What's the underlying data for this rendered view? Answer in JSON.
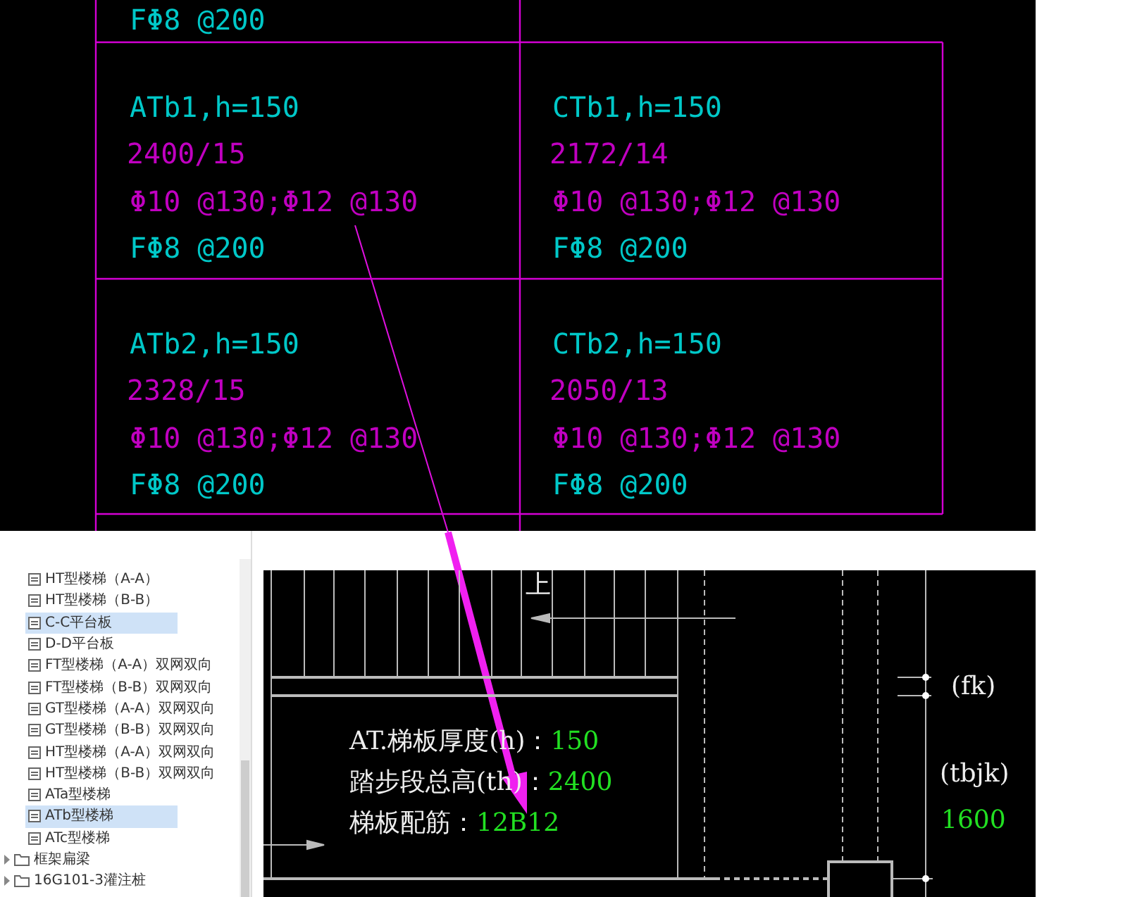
{
  "cad_table": {
    "partial_cell": "FΦ8 @200",
    "cells": [
      {
        "title": "ATb1,h=150",
        "ratio": "2400/15",
        "rebar": "Φ10 @130;Φ12 @130",
        "distribution": "FΦ8 @200"
      },
      {
        "title": "CTb1,h=150",
        "ratio": "2172/14",
        "rebar": "Φ10 @130;Φ12 @130",
        "distribution": "FΦ8 @200"
      },
      {
        "title": "ATb2,h=150",
        "ratio": "2328/15",
        "rebar": "Φ10 @130;Φ12 @130",
        "distribution": "FΦ8 @200"
      },
      {
        "title": "CTb2,h=150",
        "ratio": "2050/13",
        "rebar": "Φ10 @130;Φ12 @130",
        "distribution": "FΦ8 @200"
      }
    ]
  },
  "tree": {
    "items": [
      {
        "kind": "file",
        "label": "HT型楼梯（A-A）",
        "selected": false
      },
      {
        "kind": "file",
        "label": "HT型楼梯（B-B）",
        "selected": false
      },
      {
        "kind": "file",
        "label": "C-C平台板",
        "selected": true
      },
      {
        "kind": "file",
        "label": "D-D平台板",
        "selected": false
      },
      {
        "kind": "file",
        "label": "FT型楼梯（A-A）双网双向",
        "selected": false
      },
      {
        "kind": "file",
        "label": "FT型楼梯（B-B）双网双向",
        "selected": false
      },
      {
        "kind": "file",
        "label": "GT型楼梯（A-A）双网双向",
        "selected": false
      },
      {
        "kind": "file",
        "label": "GT型楼梯（B-B）双网双向",
        "selected": false
      },
      {
        "kind": "file",
        "label": "HT型楼梯（A-A）双网双向",
        "selected": false
      },
      {
        "kind": "file",
        "label": "HT型楼梯（B-B）双网双向",
        "selected": false
      },
      {
        "kind": "file",
        "label": "ATa型楼梯",
        "selected": false
      },
      {
        "kind": "file",
        "label": "ATb型楼梯",
        "selected": true
      },
      {
        "kind": "file",
        "label": "ATc型楼梯",
        "selected": false
      },
      {
        "kind": "folder",
        "label": "框架扁梁",
        "selected": false,
        "expanded": false
      },
      {
        "kind": "folder",
        "label": "16G101-3灌注桩",
        "selected": false,
        "expanded": false
      }
    ]
  },
  "drawing": {
    "up_mark": "上",
    "params": [
      {
        "label": "AT.梯板厚度(h)：",
        "value": "150"
      },
      {
        "label": "踏步段总高(th)：",
        "value": "2400"
      },
      {
        "label": "梯板配筋：",
        "value": "12B12"
      }
    ],
    "fk": "(fk)",
    "tbjk": "(tbjk)",
    "tbjk_value": "1600"
  }
}
